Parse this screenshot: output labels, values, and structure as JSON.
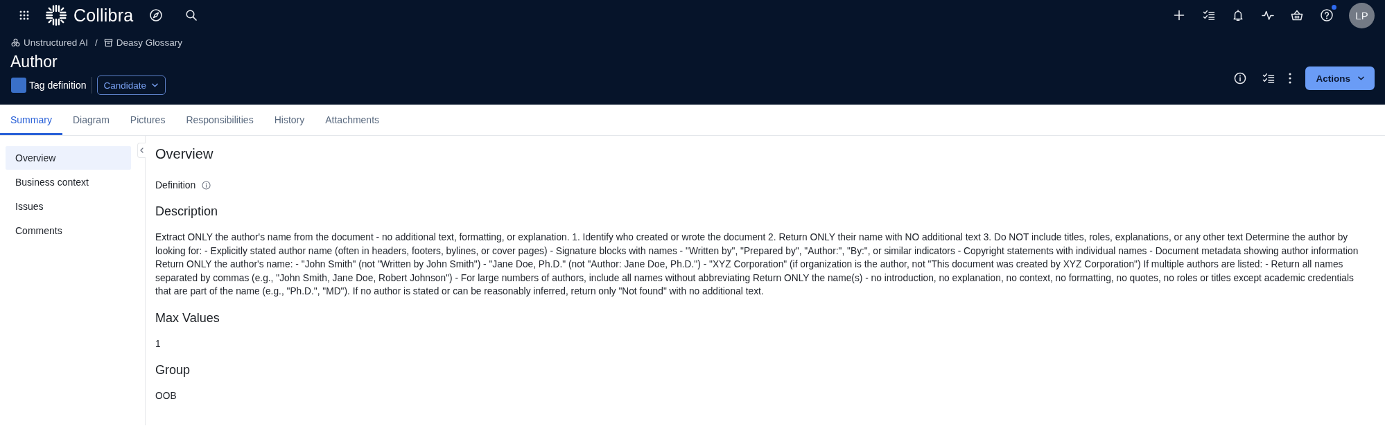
{
  "top_bar": {
    "logo_text": "Collibra",
    "help_has_notification": true,
    "avatar_initials": "LP"
  },
  "breadcrumb": {
    "separator": "/",
    "items": [
      {
        "label": "Unstructured AI",
        "kind": "community"
      },
      {
        "label": "Deasy Glossary",
        "kind": "domain"
      }
    ]
  },
  "asset": {
    "title": "Author",
    "type": "Tag definition",
    "status": "Candidate"
  },
  "toolbar": {
    "primary_button": "Actions"
  },
  "tabs": [
    {
      "label": "Summary",
      "selected": true
    },
    {
      "label": "Diagram",
      "selected": false
    },
    {
      "label": "Pictures",
      "selected": false
    },
    {
      "label": "Responsibilities",
      "selected": false
    },
    {
      "label": "History",
      "selected": false
    },
    {
      "label": "Attachments",
      "selected": false
    }
  ],
  "sidebar": {
    "items": [
      {
        "label": "Overview",
        "selected": true
      },
      {
        "label": "Business context",
        "selected": false
      },
      {
        "label": "Issues",
        "selected": false
      },
      {
        "label": "Comments",
        "selected": false
      }
    ]
  },
  "content": {
    "heading": "Overview",
    "sections": [
      {
        "kind": "label_info",
        "label": "Definition"
      },
      {
        "kind": "text",
        "heading": "Description",
        "value": "Extract ONLY the author's name from the document - no additional text, formatting, or explanation. 1. Identify who created or wrote the document 2. Return ONLY their name with NO additional text 3. Do NOT include titles, roles, explanations, or any other text Determine the author by looking for: - Explicitly stated author name (often in headers, footers, bylines, or cover pages) - Signature blocks with names - \"Written by\", \"Prepared by\", \"Author:\", \"By:\", or similar indicators - Copyright statements with individual names - Document metadata showing author information Return ONLY the author's name: - \"John Smith\" (not \"Written by John Smith\") - \"Jane Doe, Ph.D.\" (not \"Author: Jane Doe, Ph.D.\") - \"XYZ Corporation\" (if organization is the author, not \"This document was created by XYZ Corporation\") If multiple authors are listed: - Return all names separated by commas (e.g., \"John Smith, Jane Doe, Robert Johnson\") - For large numbers of authors, include all names without abbreviating Return ONLY the name(s) - no introduction, no explanation, no context, no formatting, no quotes, no roles or titles except academic credentials that are part of the name (e.g., \"Ph.D.\", \"MD\"). If no author is stated or can be reasonably inferred, return only \"Not found\" with no additional text."
      },
      {
        "kind": "text",
        "heading": "Max Values",
        "value": "1"
      },
      {
        "kind": "text",
        "heading": "Group",
        "value": "OOB"
      }
    ]
  }
}
